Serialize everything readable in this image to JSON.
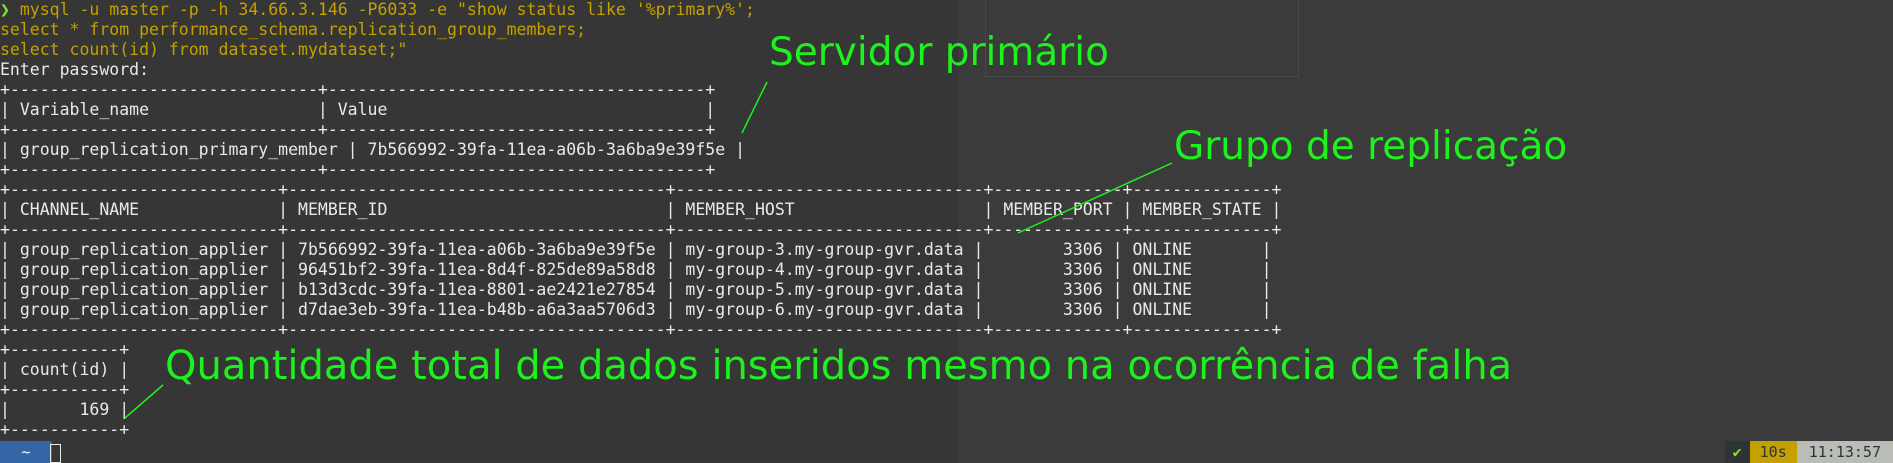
{
  "terminal": {
    "prompt_symbol": "❯",
    "command_line1": "mysql -u master -p -h 34.66.3.146 -P6033 -e ",
    "query_line1": "\"show status like '%primary%';",
    "query_line2": "select * from performance_schema.replication_group_members;",
    "query_line3": "select count(id) from dataset.mydataset;\"",
    "password_prompt": "Enter password:",
    "table1": {
      "border": "+-------------------------------+--------------------------------------+",
      "header": "| Variable_name                 | Value                                |",
      "rows": [
        "| group_replication_primary_member | 7b566992-39fa-11ea-a06b-3a6ba9e39f5e |"
      ]
    },
    "table2": {
      "border": "+---------------------------+--------------------------------------+-------------------------------+-------------+--------------+",
      "header": "| CHANNEL_NAME              | MEMBER_ID                            | MEMBER_HOST                   | MEMBER_PORT | MEMBER_STATE |",
      "rows": [
        "| group_replication_applier | 7b566992-39fa-11ea-a06b-3a6ba9e39f5e | my-group-3.my-group-gvr.data |        3306 | ONLINE       |",
        "| group_replication_applier | 96451bf2-39fa-11ea-8d4f-825de89a58d8 | my-group-4.my-group-gvr.data |        3306 | ONLINE       |",
        "| group_replication_applier | b13d3cdc-39fa-11ea-8801-ae2421e27854 | my-group-5.my-group-gvr.data |        3306 | ONLINE       |",
        "| group_replication_applier | d7dae3eb-39fa-11ea-b48b-a6a3aa5706d3 | my-group-6.my-group-gvr.data |        3306 | ONLINE       |"
      ]
    },
    "table3": {
      "border": "+-----------+",
      "header": "| count(id) |",
      "rows": [
        "|       169 |"
      ]
    }
  },
  "annotations": {
    "primary_server": "Servidor primário",
    "replication_group": "Grupo de replicação",
    "total_data": "Quantidade total de dados inseridos mesmo na ocorrência de falha"
  },
  "statusbar": {
    "cwd": "~",
    "status_icon": "✔",
    "duration": "10s",
    "clock": "11:13:57"
  },
  "colors": {
    "background": "#363636",
    "annotation": "#1df21d",
    "prompt": "#8ae234",
    "command": "#c4a000",
    "cwd_segment": "#3465a4"
  }
}
